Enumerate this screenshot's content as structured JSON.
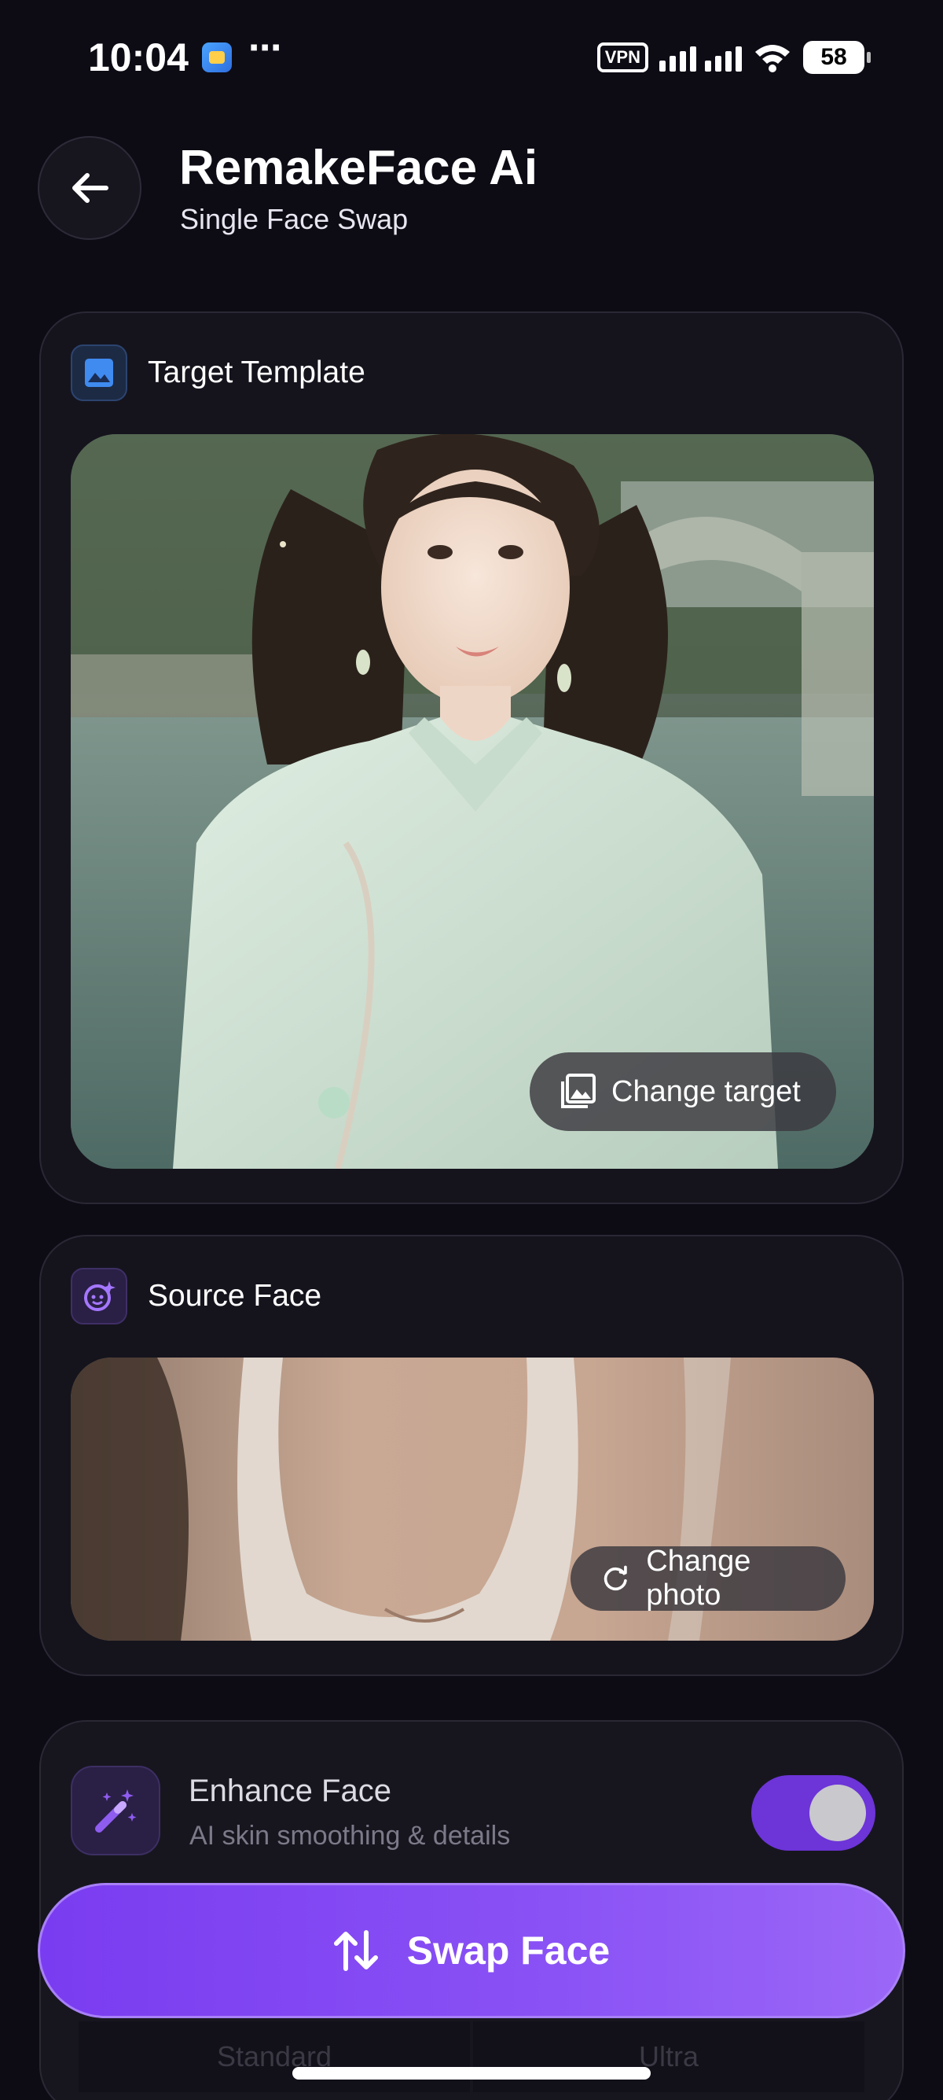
{
  "status_bar": {
    "time": "10:04",
    "dots": "⋯",
    "vpn": "VPN",
    "battery": "58"
  },
  "header": {
    "back_icon": "arrow-left-icon",
    "title": "RemakeFace Ai",
    "subtitle": "Single Face Swap"
  },
  "target": {
    "title": "Target Template",
    "icon": "image-icon",
    "change_label": "Change target",
    "change_icon": "photo-library-icon"
  },
  "source": {
    "title": "Source Face",
    "icon": "face-sparkle-icon",
    "change_label": "Change photo",
    "change_icon": "refresh-icon"
  },
  "enhance": {
    "title": "Enhance Face",
    "subtitle": "AI skin smoothing & details",
    "icon": "magic-wand-icon",
    "enabled": true
  },
  "quality": {
    "options": [
      "Standard",
      "Ultra"
    ]
  },
  "swap_button": {
    "label": "Swap Face",
    "icon": "swap-vertical-icon"
  },
  "colors": {
    "background": "#0d0c15",
    "accent": "#7a3cf0",
    "card": "#15141d",
    "toggle_on": "#6d34d8"
  }
}
